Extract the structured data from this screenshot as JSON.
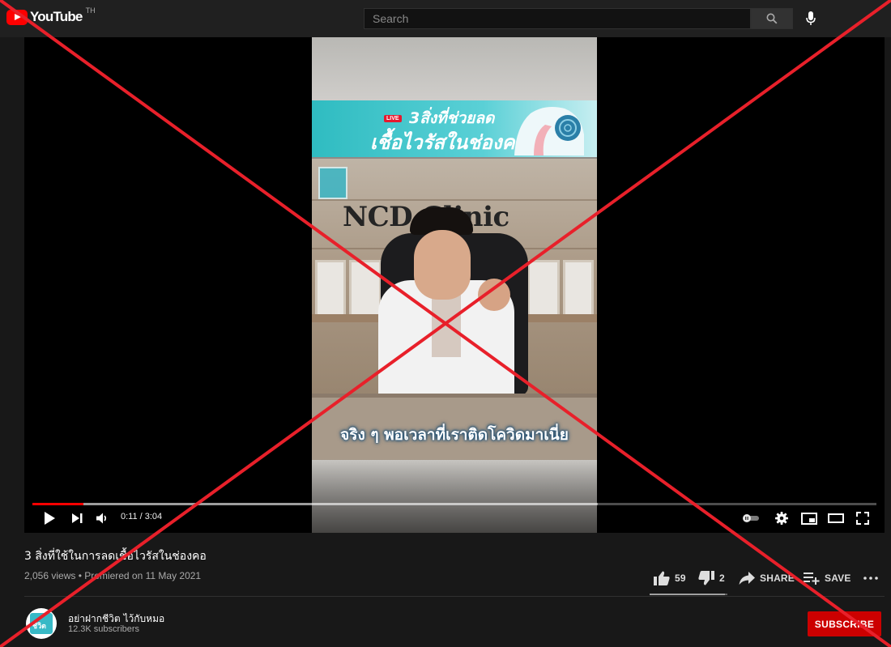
{
  "app": {
    "logo_text": "YouTube",
    "country_code": "TH"
  },
  "search": {
    "placeholder": "Search",
    "value": ""
  },
  "video": {
    "banner_live": "LIVE",
    "banner_line1": "3สิ่งที่ช่วยลด",
    "banner_line2": "เชื้อไวรัสในช่องคอ",
    "sign_text": "NCD Clinic",
    "caption": "จริง ๆ พอเวลาที่เราติดโควิดมาเนี่ย"
  },
  "player": {
    "time_display": "0:11 / 3:04",
    "progress_played_fraction": 0.06,
    "progress_loaded_fraction": 0.67
  },
  "info": {
    "title": "3 สิ่งที่ใช้ในการลดเชื้อไวรัสในช่องคอ",
    "meta": "2,056 views • Premiered on 11 May 2021",
    "likes": "59",
    "dislikes": "2",
    "share_label": "SHARE",
    "save_label": "SAVE",
    "like_ratio": 0.967
  },
  "channel": {
    "name": "อย่าฝากชีวิต ไว้กับหมอ",
    "subscribers": "12.3K subscribers",
    "avatar_text": "ชีวิต",
    "subscribe_label": "SUBSCRIBE"
  },
  "colors": {
    "brand_red": "#ff0000",
    "subscribe_red": "#cc0000",
    "overlay_cross": "#e8202a",
    "background": "#181818"
  },
  "icons": [
    "youtube-logo-icon",
    "search-icon",
    "mic-icon",
    "play-icon",
    "next-icon",
    "volume-icon",
    "autoplay-toggle-icon",
    "settings-icon",
    "miniplayer-icon",
    "theater-icon",
    "fullscreen-icon",
    "thumbs-up-icon",
    "thumbs-down-icon",
    "share-icon",
    "save-playlist-icon",
    "more-icon"
  ]
}
